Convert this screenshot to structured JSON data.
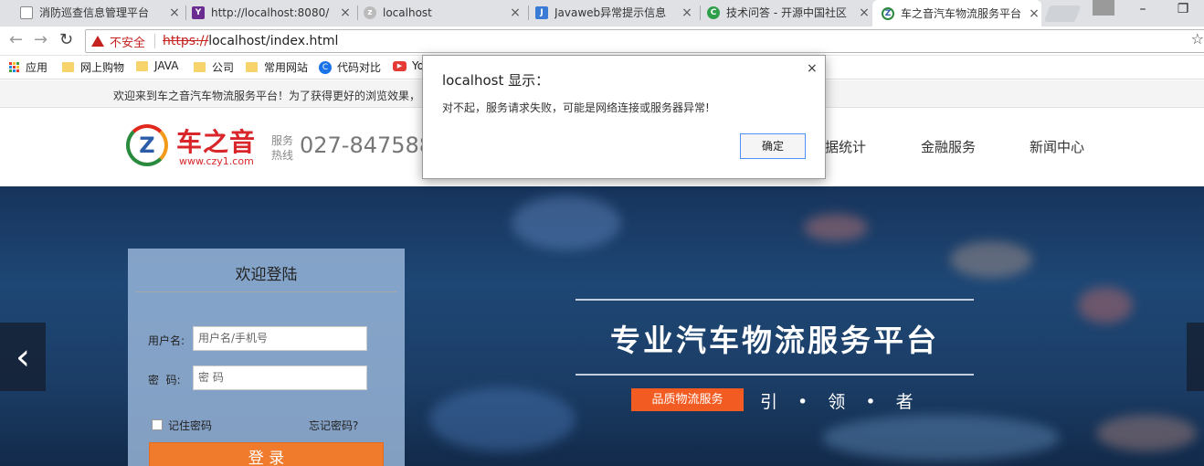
{
  "tabs": [
    {
      "title": "消防巡查信息管理平台",
      "favicon": "page-icon"
    },
    {
      "title": "http://localhost:8080/",
      "favicon": "yahoo-icon"
    },
    {
      "title": "localhost",
      "favicon": "globe-icon"
    },
    {
      "title": "Javaweb异常提示信息",
      "favicon": "javaweb-icon"
    },
    {
      "title": "技术问答 - 开源中国社区",
      "favicon": "oschina-icon"
    },
    {
      "title": "车之音汽车物流服务平台",
      "favicon": "czy-logo-icon"
    }
  ],
  "address_bar": {
    "security_label": "不安全",
    "scheme": "https://",
    "url_rest": "localhost/index.html"
  },
  "bookmarks": [
    {
      "label": "应用",
      "icon": "apps-icon"
    },
    {
      "label": "网上购物",
      "icon": "folder-icon"
    },
    {
      "label": "JAVA",
      "icon": "folder-icon"
    },
    {
      "label": "公司",
      "icon": "folder-icon"
    },
    {
      "label": "常用网站",
      "icon": "folder-icon"
    },
    {
      "label": "代码对比",
      "icon": "compare-icon"
    },
    {
      "label": "Yo",
      "icon": "youtube-icon"
    }
  ],
  "notice": "欢迎来到车之音汽车物流服务平台！为了获得更好的浏览效果，",
  "header": {
    "logo_name": "车之音",
    "logo_url": "www.czy1.com",
    "service_label": "服务热线",
    "phone": "027-84758890",
    "nav": [
      "据统计",
      "金融服务",
      "新闻中心"
    ]
  },
  "login": {
    "title": "欢迎登陆",
    "username_label": "用户名:",
    "username_placeholder": "用户名/手机号",
    "password_label": "密  码:",
    "password_placeholder": "密 码",
    "remember_label": "记住密码",
    "forgot_label": "忘记密码?",
    "submit_label": "登 录"
  },
  "banner": {
    "slogan": "专业汽车物流服务平台",
    "badge": "品质物流服务",
    "lead": "引 • 领 • 者"
  },
  "dialog": {
    "title": "localhost 显示：",
    "message": "对不起，服务请求失败，可能是网络连接或服务器异常!",
    "ok_label": "确定"
  },
  "colors": {
    "accent_orange": "#f07b2d",
    "badge_orange": "#f25b22",
    "brand_red": "#d8262b",
    "warning_red": "#c5221f"
  }
}
